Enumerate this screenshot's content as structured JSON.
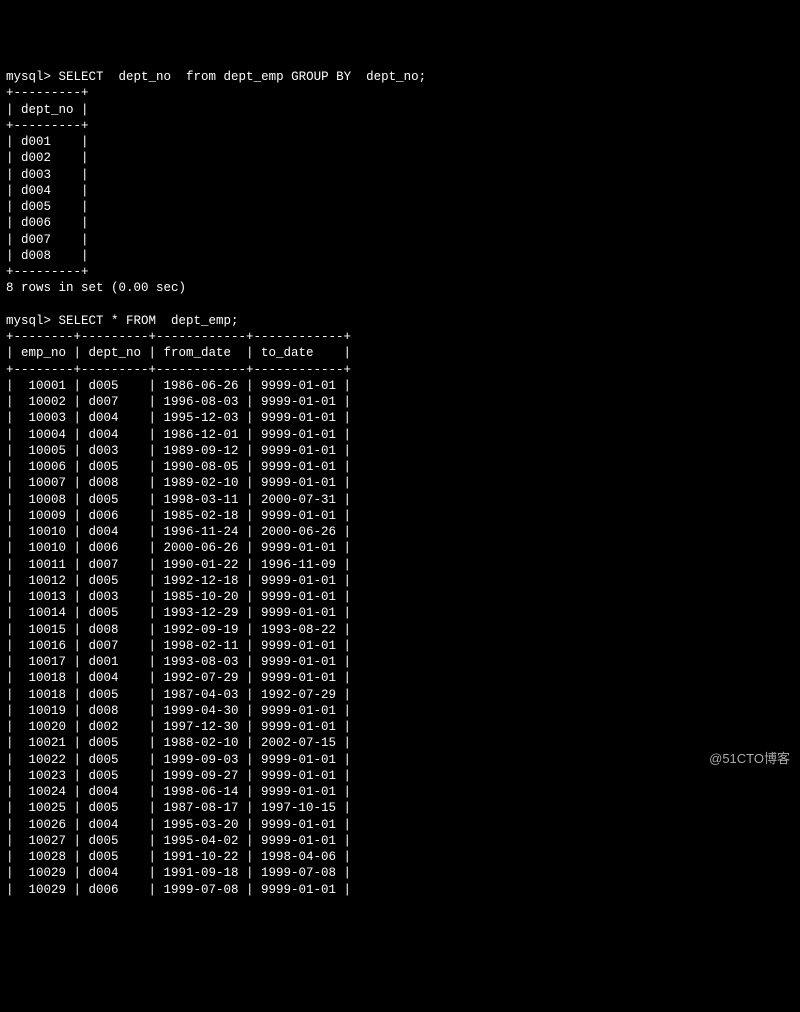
{
  "prompt": "mysql>",
  "query1": "SELECT  dept_no  from dept_emp GROUP BY  dept_no;",
  "table1": {
    "border": "+---------+",
    "header": "| dept_no |",
    "rows": [
      "| d001    |",
      "| d002    |",
      "| d003    |",
      "| d004    |",
      "| d005    |",
      "| d006    |",
      "| d007    |",
      "| d008    |"
    ],
    "footer": "8 rows in set (0.00 sec)"
  },
  "query2": "SELECT * FROM  dept_emp;",
  "table2": {
    "border": "+--------+---------+------------+------------+",
    "header": "| emp_no | dept_no | from_date  | to_date    |",
    "rows": [
      {
        "emp_no": "10001",
        "dept_no": "d005",
        "from_date": "1986-06-26",
        "to_date": "9999-01-01"
      },
      {
        "emp_no": "10002",
        "dept_no": "d007",
        "from_date": "1996-08-03",
        "to_date": "9999-01-01"
      },
      {
        "emp_no": "10003",
        "dept_no": "d004",
        "from_date": "1995-12-03",
        "to_date": "9999-01-01"
      },
      {
        "emp_no": "10004",
        "dept_no": "d004",
        "from_date": "1986-12-01",
        "to_date": "9999-01-01"
      },
      {
        "emp_no": "10005",
        "dept_no": "d003",
        "from_date": "1989-09-12",
        "to_date": "9999-01-01"
      },
      {
        "emp_no": "10006",
        "dept_no": "d005",
        "from_date": "1990-08-05",
        "to_date": "9999-01-01"
      },
      {
        "emp_no": "10007",
        "dept_no": "d008",
        "from_date": "1989-02-10",
        "to_date": "9999-01-01"
      },
      {
        "emp_no": "10008",
        "dept_no": "d005",
        "from_date": "1998-03-11",
        "to_date": "2000-07-31"
      },
      {
        "emp_no": "10009",
        "dept_no": "d006",
        "from_date": "1985-02-18",
        "to_date": "9999-01-01"
      },
      {
        "emp_no": "10010",
        "dept_no": "d004",
        "from_date": "1996-11-24",
        "to_date": "2000-06-26"
      },
      {
        "emp_no": "10010",
        "dept_no": "d006",
        "from_date": "2000-06-26",
        "to_date": "9999-01-01"
      },
      {
        "emp_no": "10011",
        "dept_no": "d007",
        "from_date": "1990-01-22",
        "to_date": "1996-11-09"
      },
      {
        "emp_no": "10012",
        "dept_no": "d005",
        "from_date": "1992-12-18",
        "to_date": "9999-01-01"
      },
      {
        "emp_no": "10013",
        "dept_no": "d003",
        "from_date": "1985-10-20",
        "to_date": "9999-01-01"
      },
      {
        "emp_no": "10014",
        "dept_no": "d005",
        "from_date": "1993-12-29",
        "to_date": "9999-01-01"
      },
      {
        "emp_no": "10015",
        "dept_no": "d008",
        "from_date": "1992-09-19",
        "to_date": "1993-08-22"
      },
      {
        "emp_no": "10016",
        "dept_no": "d007",
        "from_date": "1998-02-11",
        "to_date": "9999-01-01"
      },
      {
        "emp_no": "10017",
        "dept_no": "d001",
        "from_date": "1993-08-03",
        "to_date": "9999-01-01"
      },
      {
        "emp_no": "10018",
        "dept_no": "d004",
        "from_date": "1992-07-29",
        "to_date": "9999-01-01"
      },
      {
        "emp_no": "10018",
        "dept_no": "d005",
        "from_date": "1987-04-03",
        "to_date": "1992-07-29"
      },
      {
        "emp_no": "10019",
        "dept_no": "d008",
        "from_date": "1999-04-30",
        "to_date": "9999-01-01"
      },
      {
        "emp_no": "10020",
        "dept_no": "d002",
        "from_date": "1997-12-30",
        "to_date": "9999-01-01"
      },
      {
        "emp_no": "10021",
        "dept_no": "d005",
        "from_date": "1988-02-10",
        "to_date": "2002-07-15"
      },
      {
        "emp_no": "10022",
        "dept_no": "d005",
        "from_date": "1999-09-03",
        "to_date": "9999-01-01"
      },
      {
        "emp_no": "10023",
        "dept_no": "d005",
        "from_date": "1999-09-27",
        "to_date": "9999-01-01"
      },
      {
        "emp_no": "10024",
        "dept_no": "d004",
        "from_date": "1998-06-14",
        "to_date": "9999-01-01"
      },
      {
        "emp_no": "10025",
        "dept_no": "d005",
        "from_date": "1987-08-17",
        "to_date": "1997-10-15"
      },
      {
        "emp_no": "10026",
        "dept_no": "d004",
        "from_date": "1995-03-20",
        "to_date": "9999-01-01"
      },
      {
        "emp_no": "10027",
        "dept_no": "d005",
        "from_date": "1995-04-02",
        "to_date": "9999-01-01"
      },
      {
        "emp_no": "10028",
        "dept_no": "d005",
        "from_date": "1991-10-22",
        "to_date": "1998-04-06"
      },
      {
        "emp_no": "10029",
        "dept_no": "d004",
        "from_date": "1991-09-18",
        "to_date": "1999-07-08"
      },
      {
        "emp_no": "10029",
        "dept_no": "d006",
        "from_date": "1999-07-08",
        "to_date": "9999-01-01"
      }
    ]
  },
  "watermark": "@51CTO博客"
}
